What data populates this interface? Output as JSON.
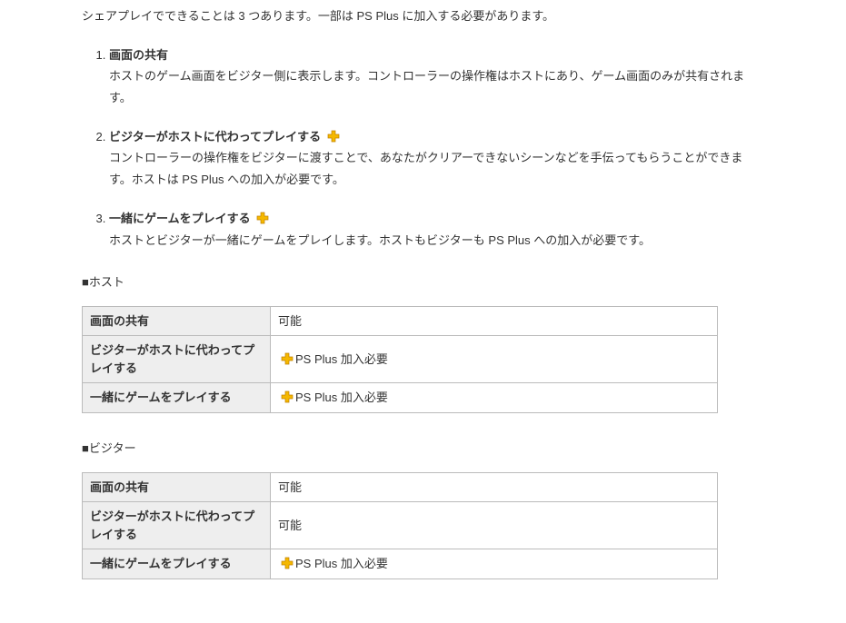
{
  "intro": "シェアプレイでできることは 3 つあります。一部は PS Plus に加入する必要があります。",
  "features": [
    {
      "title": "画面の共有",
      "hasIcon": false,
      "desc": "ホストのゲーム画面をビジター側に表示します。コントローラーの操作権はホストにあり、ゲーム画面のみが共有されます。"
    },
    {
      "title": "ビジターがホストに代わってプレイする",
      "hasIcon": true,
      "desc": "コントローラーの操作権をビジターに渡すことで、あなたがクリアーできないシーンなどを手伝ってもらうことができます。ホストは PS Plus への加入が必要です。"
    },
    {
      "title": "一緒にゲームをプレイする",
      "hasIcon": true,
      "desc": "ホストとビジターが一緒にゲームをプレイします。ホストもビジターも PS Plus への加入が必要です。"
    }
  ],
  "hostSection": {
    "label": "■ホスト"
  },
  "hostTable": [
    {
      "item": "画面の共有",
      "value": "可能",
      "icon": false
    },
    {
      "item": "ビジターがホストに代わってプレイする",
      "value": "PS Plus 加入必要",
      "icon": true
    },
    {
      "item": "一緒にゲームをプレイする",
      "value": "PS Plus 加入必要",
      "icon": true
    }
  ],
  "visitorSection": {
    "label": "■ビジター"
  },
  "visitorTable": [
    {
      "item": "画面の共有",
      "value": "可能",
      "icon": false
    },
    {
      "item": "ビジターがホストに代わってプレイする",
      "value": "可能",
      "icon": false
    },
    {
      "item": "一緒にゲームをプレイする",
      "value": "PS Plus 加入必要",
      "icon": true
    }
  ]
}
